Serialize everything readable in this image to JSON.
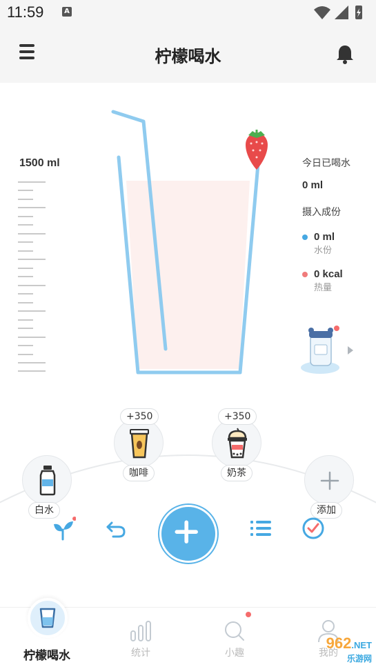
{
  "status_bar": {
    "time": "11:59",
    "notif_glyph": "A",
    "icons": [
      "wifi-icon",
      "signal-icon",
      "battery-charging-icon"
    ]
  },
  "app_bar": {
    "title": "柠檬喝水",
    "menu_icon": "menu-icon",
    "bell_icon": "bell-icon"
  },
  "glass": {
    "capacity_label": "1500 ml",
    "fill_fraction": 0.0,
    "straw_ornament": "strawberry-icon"
  },
  "stats": {
    "today_label": "今日已喝水",
    "today_value": "0 ml",
    "intake_label": "摄入成份",
    "water": {
      "value": "0 ml",
      "label": "水份",
      "color": "#46a8e2"
    },
    "calories": {
      "value": "0 kcal",
      "label": "热量",
      "color": "#f07b7b"
    }
  },
  "drinks": [
    {
      "name": "白水",
      "icon": "water-bottle-icon",
      "delta": ""
    },
    {
      "name": "咖啡",
      "icon": "coffee-cup-icon",
      "delta": "+350"
    },
    {
      "name": "奶茶",
      "icon": "milk-tea-icon",
      "delta": "+350"
    },
    {
      "name": "添加",
      "icon": "plus-icon",
      "delta": ""
    }
  ],
  "actions": [
    "sprout-icon",
    "undo-icon",
    "plus-icon",
    "list-icon",
    "check-circle-icon"
  ],
  "tabs": [
    {
      "label": "柠檬喝水",
      "icon": "water-glass-icon",
      "active": true
    },
    {
      "label": "统计",
      "icon": "bar-chart-icon",
      "active": false
    },
    {
      "label": "小趣",
      "icon": "search-icon",
      "active": false,
      "badge": true
    },
    {
      "label": "我的",
      "icon": "user-icon",
      "active": false
    }
  ],
  "watermark": {
    "brand": "962",
    "suffix": ".NET",
    "sub": "乐游网"
  },
  "colors": {
    "accent": "#59b3e8",
    "glass_fill": "#fdf0ee",
    "badge": "#f56c6c"
  }
}
